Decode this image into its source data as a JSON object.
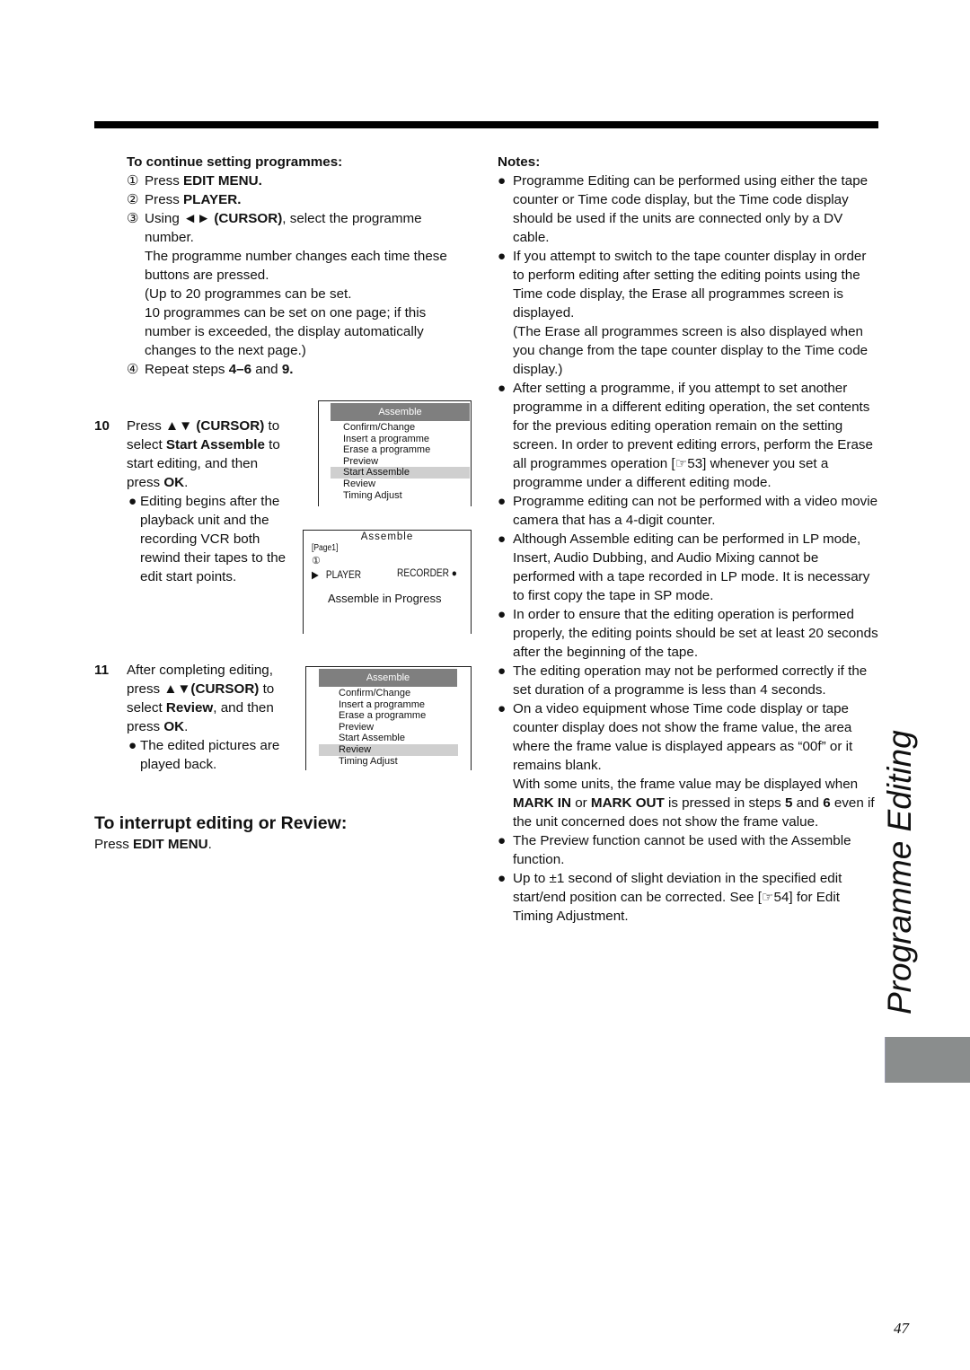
{
  "page": {
    "section_side_title": "Programme Editing",
    "page_number": "47"
  },
  "left": {
    "continue_heading": "To continue setting programmes:",
    "continue_steps": [
      {
        "marker": "①",
        "text_before": "Press ",
        "bold": "EDIT MENU.",
        "text_after": ""
      },
      {
        "marker": "②",
        "text_before": "Press ",
        "bold": "PLAYER.",
        "text_after": ""
      },
      {
        "marker": "③",
        "text_before": "Using ",
        "bold": "◄► (CURSOR)",
        "text_after": ", select the programme number.",
        "extra": [
          "The programme number changes each time these buttons are pressed.",
          "(Up to 20 programmes can be set.",
          "10 programmes can be set on one page; if this number is exceeded, the display automatically changes to the next page.)"
        ]
      },
      {
        "marker": "④",
        "text_before": "Repeat steps ",
        "bold": "4–6",
        "text_mid": " and ",
        "bold2": "9."
      }
    ],
    "step10": {
      "number": "10",
      "p1": "Press ",
      "b1": "▲▼ (CURSOR)",
      "p2": " to select ",
      "b2": "Start Assemble",
      "p3": " to start editing, and then press ",
      "b3": "OK",
      "p4": ".",
      "bullet": "Editing begins after the playback unit and the recording VCR both rewind their tapes to the edit start points."
    },
    "step11": {
      "number": "11",
      "p1": "After completing editing, press ",
      "b1": "▲▼(CURSOR)",
      "p2": " to select ",
      "b2": "Review",
      "p3": ", and then press ",
      "b3": "OK",
      "p4": ".",
      "bullet": "The edited pictures are played back."
    },
    "osd_menu_1": {
      "title": "Assemble",
      "items": [
        "Confirm/Change",
        "Insert a programme",
        "Erase a programme",
        "Preview",
        "Start Assemble",
        "Review",
        "Timing Adjust"
      ],
      "selected": "Start Assemble"
    },
    "osd_progress": {
      "title": "Assemble",
      "page": "[Page1]",
      "programme": "①",
      "player_icon": "▶",
      "player": "PLAYER",
      "recorder": "RECORDER",
      "recorder_icon": "●",
      "status": "Assemble in Progress"
    },
    "osd_menu_2": {
      "title": "Assemble",
      "items": [
        "Confirm/Change",
        "Insert a programme",
        "Erase a programme",
        "Preview",
        "Start Assemble",
        "Review",
        "Timing Adjust"
      ],
      "selected": "Review"
    },
    "interrupt": {
      "title": "To interrupt editing or Review:",
      "body_before": "Press ",
      "body_bold": "EDIT MENU",
      "body_after": "."
    }
  },
  "notes": {
    "title": "Notes:",
    "items": [
      {
        "text": "Programme Editing can be performed using either the tape counter or Time code display, but the Time code display should be used if the units are connected only by a DV cable."
      },
      {
        "text": "If you attempt to switch to the tape counter display in order to perform editing after setting the editing points using the Time code display, the Erase all programmes screen is displayed.",
        "extra": "(The Erase all programmes screen is also displayed when you change from the tape counter display to the Time code display.)"
      },
      {
        "text": "After setting a programme, if you attempt to set another programme in a different editing operation, the set contents for the previous editing operation remain on the setting screen.  In order to prevent editing errors, perform the Erase all programmes operation [☞53] whenever you set a programme under a different editing mode."
      },
      {
        "text": "Programme editing can not be performed with a video movie camera that has a 4-digit counter."
      },
      {
        "text": "Although Assemble editing can be performed in LP mode, Insert, Audio Dubbing, and Audio Mixing cannot be performed with a tape recorded in LP mode.  It is necessary to first copy the tape in SP mode."
      },
      {
        "text": "In order to ensure that the editing operation is performed properly, the editing points should be set at least 20 seconds after the beginning of the tape."
      },
      {
        "text": "The editing operation may not be performed correctly if the set duration of a programme is less than 4 seconds."
      },
      {
        "text": "On a video equipment whose Time code display or tape counter display does not show the frame value, the area where the frame value is displayed appears as “00f” or it remains blank."
      },
      {
        "text": "The Preview function cannot be used with the Assemble function."
      },
      {
        "text": "Up to ±1 second of slight deviation in the specified edit start/end position can be corrected. See [☞54] for Edit Timing Adjustment."
      }
    ],
    "note8_extra": {
      "p1": "With some units, the frame value may be displayed when ",
      "b1": "MARK IN",
      "p2": " or ",
      "b2": "MARK OUT",
      "p3": " is pressed in steps ",
      "b3": "5",
      "p4": " and ",
      "b4": "6",
      "p5": " even if the unit concerned does not show the frame value."
    }
  }
}
